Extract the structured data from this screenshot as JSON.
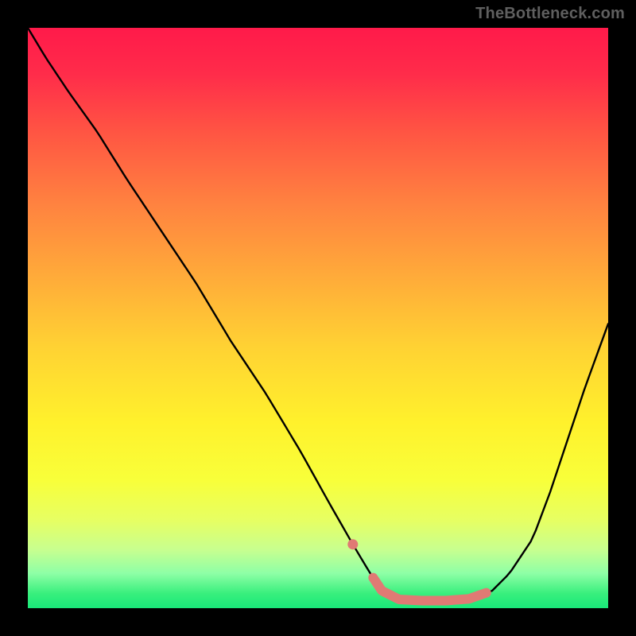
{
  "attribution": "TheBottleneck.com",
  "colors": {
    "background": "#000000",
    "attribution_text": "#5f5f5f",
    "curve": "#000000",
    "highlight": "#e07a74",
    "gradient_stops": [
      {
        "offset": 0.0,
        "color": "#ff1a4a"
      },
      {
        "offset": 0.08,
        "color": "#ff2c4a"
      },
      {
        "offset": 0.18,
        "color": "#ff5543"
      },
      {
        "offset": 0.3,
        "color": "#ff8140"
      },
      {
        "offset": 0.42,
        "color": "#ffa83a"
      },
      {
        "offset": 0.55,
        "color": "#ffd233"
      },
      {
        "offset": 0.68,
        "color": "#fff12c"
      },
      {
        "offset": 0.78,
        "color": "#f8ff3a"
      },
      {
        "offset": 0.85,
        "color": "#e6ff64"
      },
      {
        "offset": 0.9,
        "color": "#c7ff90"
      },
      {
        "offset": 0.94,
        "color": "#8effa6"
      },
      {
        "offset": 0.975,
        "color": "#38ef7d"
      },
      {
        "offset": 1.0,
        "color": "#19e879"
      }
    ]
  },
  "chart_data": {
    "type": "line",
    "title": "",
    "xlabel": "",
    "ylabel": "",
    "xlim": [
      0,
      100
    ],
    "ylim": [
      0,
      100
    ],
    "grid": false,
    "legend": "none",
    "series": [
      {
        "name": "bottleneck_curve",
        "x": [
          0,
          3,
          7,
          12,
          17,
          23,
          29,
          35,
          41,
          47,
          52,
          56,
          59,
          61,
          64,
          68,
          72,
          76,
          80,
          83,
          87,
          90,
          93,
          96,
          100
        ],
        "values": [
          100,
          95,
          89,
          82,
          74,
          65,
          56,
          46,
          37,
          27,
          18,
          11,
          6,
          3,
          1.5,
          1.3,
          1.3,
          1.6,
          3,
          6,
          12,
          20,
          29,
          38,
          49
        ]
      }
    ],
    "highlight_range": {
      "x_start": 56,
      "x_end": 79
    }
  }
}
